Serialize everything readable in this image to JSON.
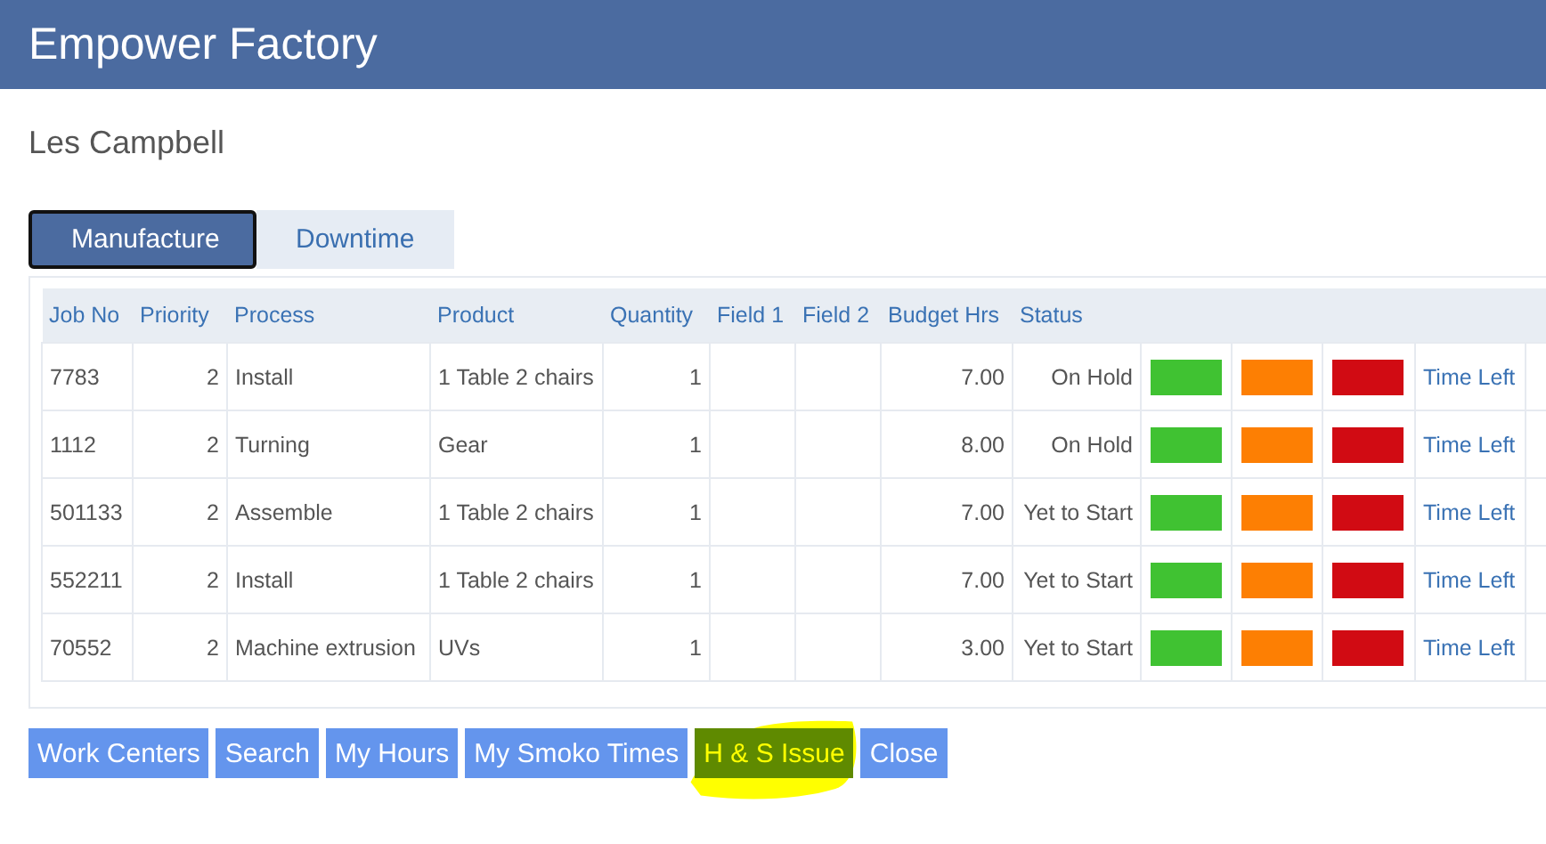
{
  "header": {
    "title": "Empower Factory"
  },
  "user": "Les Campbell",
  "tabs": [
    {
      "label": "Manufacture",
      "selected": true
    },
    {
      "label": "Downtime",
      "selected": false
    }
  ],
  "table": {
    "columns": [
      "Job No",
      "Priority",
      "Process",
      "Product",
      "Quantity",
      "Field 1",
      "Field 2",
      "Budget Hrs",
      "Status"
    ],
    "rows": [
      {
        "job_no": "7783",
        "priority": "2",
        "process": "Install",
        "product": "1 Table 2 chairs",
        "quantity": "1",
        "field_1": "",
        "field_2": "",
        "budget_hrs": "7.00",
        "status": "On Hold",
        "signals": [
          {
            "color": "#40c232"
          },
          {
            "color": "#fd7f03"
          },
          {
            "color": "#d10b13"
          }
        ],
        "link": "Time Left"
      },
      {
        "job_no": "1112",
        "priority": "2",
        "process": "Turning",
        "product": "Gear",
        "quantity": "1",
        "field_1": "",
        "field_2": "",
        "budget_hrs": "8.00",
        "status": "On Hold",
        "signals": [
          {
            "color": "#40c232"
          },
          {
            "color": "#fd7f03"
          },
          {
            "color": "#d10b13"
          }
        ],
        "link": "Time Left"
      },
      {
        "job_no": "501133",
        "priority": "2",
        "process": "Assemble",
        "product": "1 Table 2 chairs",
        "quantity": "1",
        "field_1": "",
        "field_2": "",
        "budget_hrs": "7.00",
        "status": "Yet to Start",
        "signals": [
          {
            "color": "#40c232"
          },
          {
            "color": "#fd7f03"
          },
          {
            "color": "#d10b13"
          }
        ],
        "link": "Time Left"
      },
      {
        "job_no": "552211",
        "priority": "2",
        "process": "Install",
        "product": "1 Table 2 chairs",
        "quantity": "1",
        "field_1": "",
        "field_2": "",
        "budget_hrs": "7.00",
        "status": "Yet to Start",
        "signals": [
          {
            "color": "#40c232"
          },
          {
            "color": "#fd7f03"
          },
          {
            "color": "#d10b13"
          }
        ],
        "link": "Time Left"
      },
      {
        "job_no": "70552",
        "priority": "2",
        "process": "Machine extrusion",
        "product": "UVs",
        "quantity": "1",
        "field_1": "",
        "field_2": "",
        "budget_hrs": "3.00",
        "status": "Yet to Start",
        "signals": [
          {
            "color": "#40c232"
          },
          {
            "color": "#fd7f03"
          },
          {
            "color": "#d10b13"
          }
        ],
        "link": "Time Left"
      }
    ]
  },
  "buttons": [
    {
      "label": "Work Centers",
      "highlighted": false
    },
    {
      "label": "Search",
      "highlighted": false
    },
    {
      "label": "My Hours",
      "highlighted": false
    },
    {
      "label": "My Smoko Times",
      "highlighted": false
    },
    {
      "label": "H & S Issue",
      "highlighted": true
    },
    {
      "label": "Close",
      "highlighted": false
    }
  ]
}
